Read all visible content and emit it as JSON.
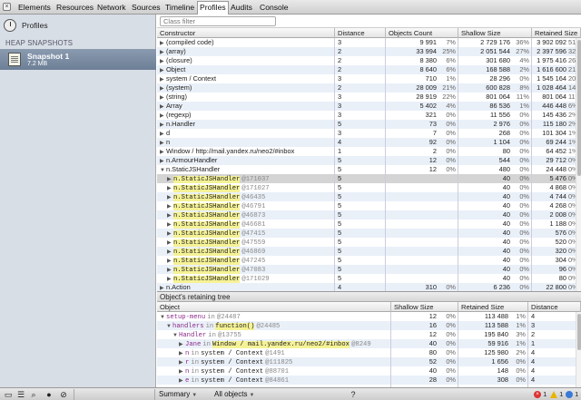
{
  "tabs": [
    {
      "label": "Elements",
      "active": false
    },
    {
      "label": "Resources",
      "active": false
    },
    {
      "label": "Network",
      "active": false
    },
    {
      "label": "Sources",
      "active": false
    },
    {
      "label": "Timeline",
      "active": false
    },
    {
      "label": "Profiles",
      "active": true
    },
    {
      "label": "Audits",
      "active": false
    },
    {
      "label": "Console",
      "active": false
    }
  ],
  "sidebar": {
    "profiles_label": "Profiles",
    "heading": "HEAP SNAPSHOTS",
    "snapshot": {
      "title": "Snapshot 1",
      "size": "7.2 MB"
    }
  },
  "filter": {
    "placeholder": "Class filter"
  },
  "constructors": {
    "columns": [
      "Constructor",
      "Distance",
      "Objects Count",
      "Shallow Size",
      "Retained Size"
    ],
    "rows": [
      {
        "type": "ctor",
        "name": "(compiled code)",
        "distance": "3",
        "count": "9 991",
        "count_pct": "7%",
        "shallow": "2 729 176",
        "shallow_pct": "36%",
        "retained": "3 902 092",
        "retained_pct": "51%"
      },
      {
        "type": "ctor",
        "name": "(array)",
        "distance": "2",
        "count": "33 994",
        "count_pct": "25%",
        "shallow": "2 051 544",
        "shallow_pct": "27%",
        "retained": "2 397 596",
        "retained_pct": "32%"
      },
      {
        "type": "ctor",
        "name": "(closure)",
        "distance": "2",
        "count": "8 380",
        "count_pct": "6%",
        "shallow": "301 680",
        "shallow_pct": "4%",
        "retained": "1 975 416",
        "retained_pct": "26%"
      },
      {
        "type": "ctor",
        "name": "Object",
        "distance": "2",
        "count": "8 640",
        "count_pct": "6%",
        "shallow": "168 588",
        "shallow_pct": "2%",
        "retained": "1 616 600",
        "retained_pct": "21%"
      },
      {
        "type": "ctor",
        "name": "system / Context",
        "distance": "3",
        "count": "710",
        "count_pct": "1%",
        "shallow": "28 296",
        "shallow_pct": "0%",
        "retained": "1 545 164",
        "retained_pct": "20%"
      },
      {
        "type": "ctor",
        "name": "(system)",
        "distance": "2",
        "count": "28 009",
        "count_pct": "21%",
        "shallow": "600 828",
        "shallow_pct": "8%",
        "retained": "1 028 464",
        "retained_pct": "14%"
      },
      {
        "type": "ctor",
        "name": "(string)",
        "distance": "3",
        "count": "28 919",
        "count_pct": "22%",
        "shallow": "801 064",
        "shallow_pct": "11%",
        "retained": "801 064",
        "retained_pct": "11%"
      },
      {
        "type": "ctor",
        "name": "Array",
        "distance": "3",
        "count": "5 402",
        "count_pct": "4%",
        "shallow": "86 536",
        "shallow_pct": "1%",
        "retained": "446 448",
        "retained_pct": "6%"
      },
      {
        "type": "ctor",
        "name": "(regexp)",
        "distance": "3",
        "count": "321",
        "count_pct": "0%",
        "shallow": "11 556",
        "shallow_pct": "0%",
        "retained": "145 436",
        "retained_pct": "2%"
      },
      {
        "type": "ctor",
        "name": "n.Handler",
        "distance": "5",
        "count": "73",
        "count_pct": "0%",
        "shallow": "2 976",
        "shallow_pct": "0%",
        "retained": "115 180",
        "retained_pct": "2%"
      },
      {
        "type": "ctor",
        "name": "d",
        "distance": "3",
        "count": "7",
        "count_pct": "0%",
        "shallow": "268",
        "shallow_pct": "0%",
        "retained": "101 304",
        "retained_pct": "1%"
      },
      {
        "type": "ctor",
        "name": "n",
        "distance": "4",
        "count": "92",
        "count_pct": "0%",
        "shallow": "1 104",
        "shallow_pct": "0%",
        "retained": "69 244",
        "retained_pct": "1%"
      },
      {
        "type": "ctor",
        "name": "Window / http://mail.yandex.ru/neo2/#inbox",
        "distance": "1",
        "count": "2",
        "count_pct": "0%",
        "shallow": "80",
        "shallow_pct": "0%",
        "retained": "64 452",
        "retained_pct": "1%"
      },
      {
        "type": "ctor",
        "name": "n.ArmourHandler",
        "distance": "5",
        "count": "12",
        "count_pct": "0%",
        "shallow": "544",
        "shallow_pct": "0%",
        "retained": "29 712",
        "retained_pct": "0%"
      },
      {
        "type": "ctor",
        "name": "n.StaticJSHandler",
        "distance": "5",
        "count": "12",
        "count_pct": "0%",
        "shallow": "480",
        "shallow_pct": "0%",
        "retained": "24 448",
        "retained_pct": "0%",
        "expanded": true
      },
      {
        "type": "inst",
        "name": "n.StaticJSHandler",
        "id": "@171037",
        "distance": "5",
        "shallow": "40",
        "shallow_pct": "0%",
        "retained": "5 476",
        "retained_pct": "0%",
        "selected": true
      },
      {
        "type": "inst",
        "name": "n.StaticJSHandler",
        "id": "@171027",
        "distance": "5",
        "shallow": "40",
        "shallow_pct": "0%",
        "retained": "4 868",
        "retained_pct": "0%"
      },
      {
        "type": "inst",
        "name": "n.StaticJSHandler",
        "id": "@46435",
        "distance": "5",
        "shallow": "40",
        "shallow_pct": "0%",
        "retained": "4 744",
        "retained_pct": "0%"
      },
      {
        "type": "inst",
        "name": "n.StaticJSHandler",
        "id": "@46791",
        "distance": "5",
        "shallow": "40",
        "shallow_pct": "0%",
        "retained": "4 268",
        "retained_pct": "0%"
      },
      {
        "type": "inst",
        "name": "n.StaticJSHandler",
        "id": "@46873",
        "distance": "5",
        "shallow": "40",
        "shallow_pct": "0%",
        "retained": "2 008",
        "retained_pct": "0%"
      },
      {
        "type": "inst",
        "name": "n.StaticJSHandler",
        "id": "@46681",
        "distance": "5",
        "shallow": "40",
        "shallow_pct": "0%",
        "retained": "1 188",
        "retained_pct": "0%"
      },
      {
        "type": "inst",
        "name": "n.StaticJSHandler",
        "id": "@47415",
        "distance": "5",
        "shallow": "40",
        "shallow_pct": "0%",
        "retained": "576",
        "retained_pct": "0%"
      },
      {
        "type": "inst",
        "name": "n.StaticJSHandler",
        "id": "@47559",
        "distance": "5",
        "shallow": "40",
        "shallow_pct": "0%",
        "retained": "520",
        "retained_pct": "0%"
      },
      {
        "type": "inst",
        "name": "n.StaticJSHandler",
        "id": "@46869",
        "distance": "5",
        "shallow": "40",
        "shallow_pct": "0%",
        "retained": "320",
        "retained_pct": "0%"
      },
      {
        "type": "inst",
        "name": "n.StaticJSHandler",
        "id": "@47245",
        "distance": "5",
        "shallow": "40",
        "shallow_pct": "0%",
        "retained": "304",
        "retained_pct": "0%"
      },
      {
        "type": "inst",
        "name": "n.StaticJSHandler",
        "id": "@47083",
        "distance": "5",
        "shallow": "40",
        "shallow_pct": "0%",
        "retained": "96",
        "retained_pct": "0%"
      },
      {
        "type": "inst",
        "name": "n.StaticJSHandler",
        "id": "@171029",
        "distance": "5",
        "shallow": "40",
        "shallow_pct": "0%",
        "retained": "80",
        "retained_pct": "0%"
      },
      {
        "type": "ctor",
        "name": "n.Action",
        "distance": "4",
        "count": "310",
        "count_pct": "0%",
        "shallow": "6 236",
        "shallow_pct": "0%",
        "retained": "22 800",
        "retained_pct": "0%"
      }
    ]
  },
  "retaining": {
    "title": "Object's retaining tree",
    "columns": [
      "Object",
      "Shallow Size",
      "Retained Size",
      "Distance"
    ],
    "rows": [
      {
        "indent": 0,
        "open": true,
        "prop": "setup-menu",
        "in": "in",
        "obj": "",
        "id": "@24487",
        "shallow": "12",
        "shallow_pct": "0%",
        "retained": "113 488",
        "retained_pct": "1%",
        "distance": "4"
      },
      {
        "indent": 1,
        "open": true,
        "prop": "handlers",
        "in": "in",
        "obj": "function()",
        "id": "@24485",
        "shallow": "16",
        "shallow_pct": "0%",
        "retained": "113 588",
        "retained_pct": "1%",
        "distance": "3"
      },
      {
        "indent": 2,
        "open": true,
        "prop": "Handler",
        "in": "in",
        "obj": "",
        "id": "@13755",
        "shallow": "12",
        "shallow_pct": "0%",
        "retained": "195 840",
        "retained_pct": "3%",
        "distance": "2"
      },
      {
        "indent": 3,
        "open": false,
        "prop": "Jane",
        "in": "in",
        "obj": "Window / mail.yandex.ru/neo2/#inbox",
        "id": "@8249",
        "shallow": "40",
        "shallow_pct": "0%",
        "retained": "59 916",
        "retained_pct": "1%",
        "distance": "1"
      },
      {
        "indent": 3,
        "open": false,
        "prop": "n",
        "in": "in",
        "obj": "system / Context",
        "id": "@1491",
        "shallow": "80",
        "shallow_pct": "0%",
        "retained": "125 980",
        "retained_pct": "2%",
        "distance": "4"
      },
      {
        "indent": 3,
        "open": false,
        "prop": "r",
        "in": "in",
        "obj": "system / Context",
        "id": "@111825",
        "shallow": "52",
        "shallow_pct": "0%",
        "retained": "1 656",
        "retained_pct": "0%",
        "distance": "4"
      },
      {
        "indent": 3,
        "open": false,
        "prop": "n",
        "in": "in",
        "obj": "system / Context",
        "id": "@88701",
        "shallow": "40",
        "shallow_pct": "0%",
        "retained": "148",
        "retained_pct": "0%",
        "distance": "4"
      },
      {
        "indent": 3,
        "open": false,
        "prop": "e",
        "in": "in",
        "obj": "system / Context",
        "id": "@84861",
        "shallow": "28",
        "shallow_pct": "0%",
        "retained": "308",
        "retained_pct": "0%",
        "distance": "4"
      }
    ]
  },
  "status": {
    "view": "Summary",
    "filter": "All objects",
    "help": "?",
    "errors": "1",
    "warnings": "1",
    "info": "1"
  }
}
